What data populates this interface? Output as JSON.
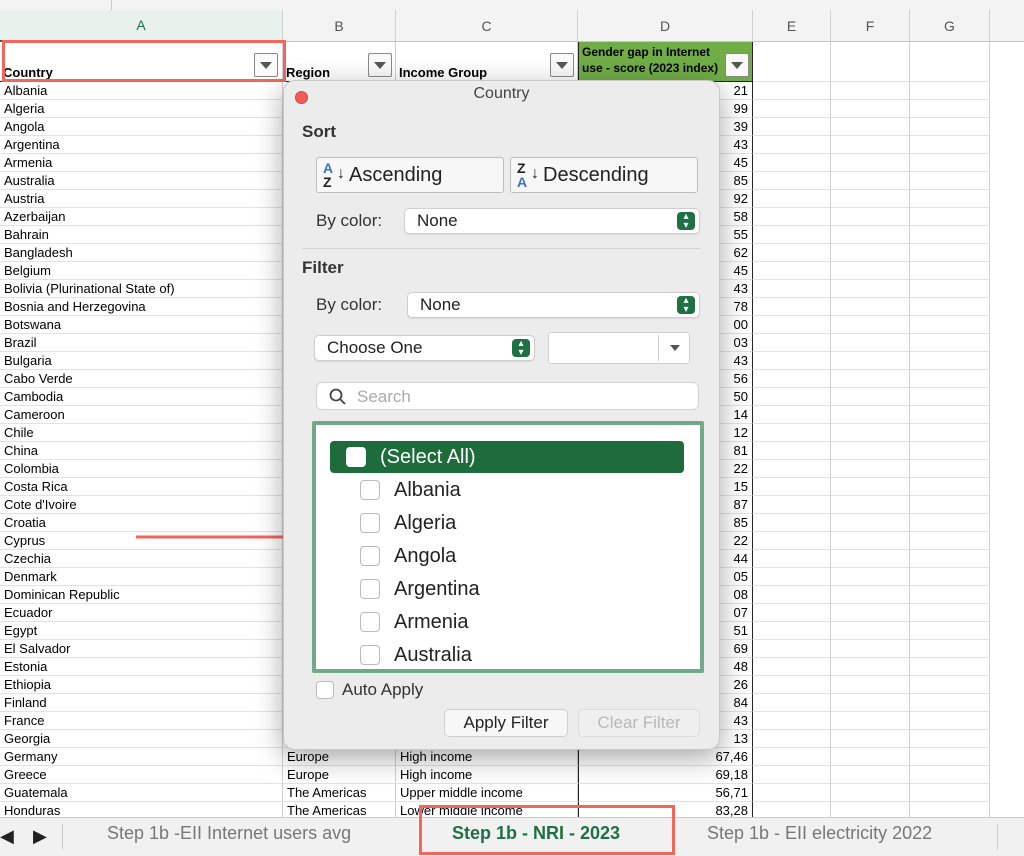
{
  "columns": [
    "A",
    "B",
    "C",
    "D",
    "E",
    "F",
    "G"
  ],
  "headers": {
    "country": "Country",
    "region": "Region",
    "income": "Income Group",
    "gender_gap": "Gender gap in Internet use - score (2023 index)"
  },
  "rows": [
    {
      "country": "Albania",
      "value": "21"
    },
    {
      "country": "Algeria",
      "value": "99"
    },
    {
      "country": "Angola",
      "value": "39"
    },
    {
      "country": "Argentina",
      "value": "43"
    },
    {
      "country": "Armenia",
      "value": "45"
    },
    {
      "country": "Australia",
      "value": "85"
    },
    {
      "country": "Austria",
      "value": "92"
    },
    {
      "country": "Azerbaijan",
      "value": "58"
    },
    {
      "country": "Bahrain",
      "value": "55"
    },
    {
      "country": "Bangladesh",
      "value": "62"
    },
    {
      "country": "Belgium",
      "value": "45"
    },
    {
      "country": "Bolivia (Plurinational State of)",
      "value": "43"
    },
    {
      "country": "Bosnia and Herzegovina",
      "value": "78"
    },
    {
      "country": "Botswana",
      "value": "00"
    },
    {
      "country": "Brazil",
      "value": "03"
    },
    {
      "country": "Bulgaria",
      "value": "43"
    },
    {
      "country": "Cabo Verde",
      "value": "56"
    },
    {
      "country": "Cambodia",
      "value": "50"
    },
    {
      "country": "Cameroon",
      "value": "14"
    },
    {
      "country": "Chile",
      "value": "12"
    },
    {
      "country": "China",
      "value": "81"
    },
    {
      "country": "Colombia",
      "value": "22"
    },
    {
      "country": "Costa Rica",
      "value": "15"
    },
    {
      "country": "Cote d'Ivoire",
      "value": "87"
    },
    {
      "country": "Croatia",
      "value": "85"
    },
    {
      "country": "Cyprus",
      "value": "22"
    },
    {
      "country": "Czechia",
      "value": "44"
    },
    {
      "country": "Denmark",
      "value": "05"
    },
    {
      "country": "Dominican Republic",
      "value": "08"
    },
    {
      "country": "Ecuador",
      "value": "07"
    },
    {
      "country": "Egypt",
      "value": "51"
    },
    {
      "country": "El Salvador",
      "value": "69"
    },
    {
      "country": "Estonia",
      "value": "48"
    },
    {
      "country": "Ethiopia",
      "value": "26"
    },
    {
      "country": "Finland",
      "value": "84"
    },
    {
      "country": "France",
      "value": "43"
    },
    {
      "country": "Georgia",
      "value": "13"
    },
    {
      "country": "Germany",
      "region": "Europe",
      "income": "High income",
      "value": "67,46"
    },
    {
      "country": "Greece",
      "region": "Europe",
      "income": "High income",
      "value": "69,18"
    },
    {
      "country": "Guatemala",
      "region": "The Americas",
      "income": "Upper middle income",
      "value": "56,71"
    },
    {
      "country": "Honduras",
      "region": "The Americas",
      "income": "Lower middle income",
      "value": "83,28"
    }
  ],
  "popover": {
    "title": "Country",
    "sort_heading": "Sort",
    "ascending": "Ascending",
    "descending": "Descending",
    "az_top": "A",
    "az_bottom": "Z",
    "za_top": "Z",
    "za_bottom": "A",
    "by_color_label": "By color:",
    "sort_color_value": "None",
    "filter_heading": "Filter",
    "filter_color_value": "None",
    "choose_one": "Choose One",
    "search_placeholder": "Search",
    "list": [
      "(Select All)",
      "Albania",
      "Algeria",
      "Angola",
      "Argentina",
      "Armenia",
      "Australia"
    ],
    "auto_apply": "Auto Apply",
    "apply_filter": "Apply Filter",
    "clear_filter": "Clear Filter"
  },
  "tabs": [
    "Step 1b -EII Internet users avg",
    "Step 1b - NRI - 2023",
    "Step 1b - EII electricity 2022"
  ],
  "active_tab_index": 1,
  "colors": {
    "accent": "#1e7145",
    "highlight_box": "#f2665c",
    "header_green": "#70ad47"
  }
}
